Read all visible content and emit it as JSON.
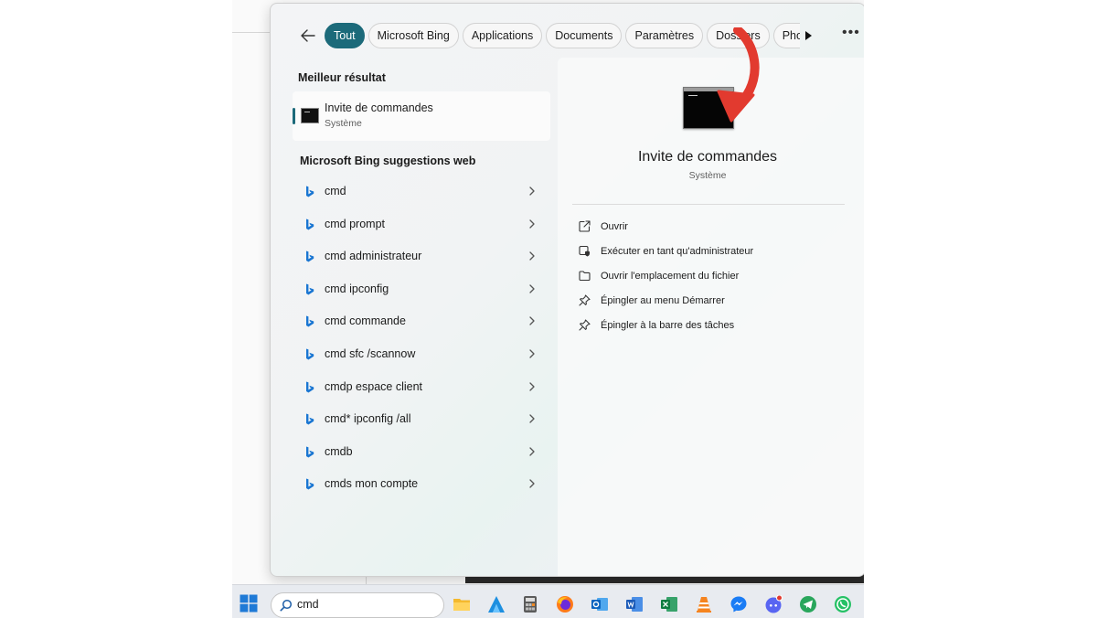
{
  "filters": {
    "items": [
      {
        "label": "Tout",
        "active": true
      },
      {
        "label": "Microsoft Bing"
      },
      {
        "label": "Applications"
      },
      {
        "label": "Documents"
      },
      {
        "label": "Paramètres"
      },
      {
        "label": "Dossiers"
      },
      {
        "label": "Pho"
      }
    ]
  },
  "best": {
    "heading": "Meilleur résultat",
    "title": "Invite de commandes",
    "subtitle": "Système"
  },
  "suggestions": {
    "heading": "Microsoft Bing suggestions web",
    "items": [
      "cmd",
      "cmd prompt",
      "cmd administrateur",
      "cmd ipconfig",
      "cmd commande",
      "cmd sfc /scannow",
      "cmdp espace client",
      "cmd* ipconfig /all",
      "cmdb",
      "cmds mon compte"
    ]
  },
  "preview": {
    "title": "Invite de commandes",
    "subtitle": "Système",
    "actions": [
      {
        "label": "Ouvrir",
        "icon": "open-external-icon"
      },
      {
        "label": "Exécuter en tant qu'administrateur",
        "icon": "shield-icon"
      },
      {
        "label": "Ouvrir l'emplacement du fichier",
        "icon": "folder-icon"
      },
      {
        "label": "Épingler au menu Démarrer",
        "icon": "pin-icon"
      },
      {
        "label": "Épingler à la barre des tâches",
        "icon": "pin-icon"
      }
    ]
  },
  "taskbar": {
    "search_value": "cmd",
    "apps": [
      "file-explorer-icon",
      "app-a-icon",
      "calculator-icon",
      "firefox-icon",
      "outlook-icon",
      "word-icon",
      "excel-icon",
      "vlc-icon",
      "messenger-icon",
      "discord-icon",
      "telegram-icon",
      "whatsapp-icon"
    ]
  },
  "colors": {
    "accent": "#1c6a7a",
    "annotation_arrow": "#e23a2f",
    "bing": "#1a76d2"
  }
}
